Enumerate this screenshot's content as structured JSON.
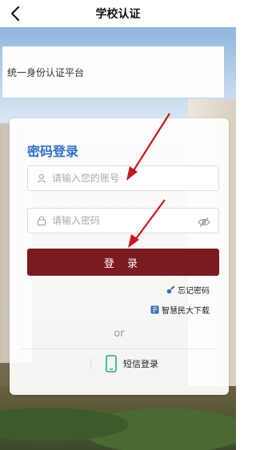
{
  "header": {
    "title": "学校认证"
  },
  "banner": {
    "text": "统一身份认证平台"
  },
  "card": {
    "title": "密码登录",
    "account_placeholder": "请输入您的账号",
    "password_placeholder": "请输入密码",
    "login_label": "登 录",
    "forgot_label": "忘记密码",
    "download_label": "智慧民大下载",
    "or_label": "or",
    "sms_label": "短信登录"
  },
  "colors": {
    "accent": "#2c6fd0",
    "button": "#7a1b1f",
    "annotation_arrow": "#c8191e"
  }
}
